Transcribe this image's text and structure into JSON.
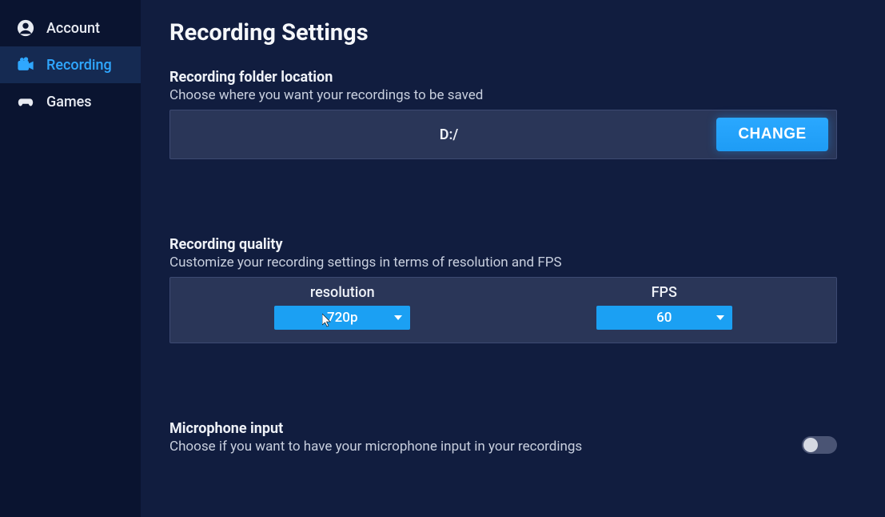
{
  "sidebar": {
    "items": [
      {
        "label": "Account"
      },
      {
        "label": "Recording"
      },
      {
        "label": "Games"
      }
    ]
  },
  "page": {
    "title": "Recording Settings"
  },
  "folder": {
    "title": "Recording folder location",
    "desc": "Choose where you want your recordings to be saved",
    "path": "D:/",
    "button": "CHANGE"
  },
  "quality": {
    "title": "Recording quality",
    "desc": "Customize your recording settings in terms of resolution and FPS",
    "resolution_label": "resolution",
    "resolution_value": "720p",
    "fps_label": "FPS",
    "fps_value": "60"
  },
  "mic": {
    "title": "Microphone input",
    "desc": "Choose if you want to have your microphone input in your recordings",
    "enabled": false
  }
}
